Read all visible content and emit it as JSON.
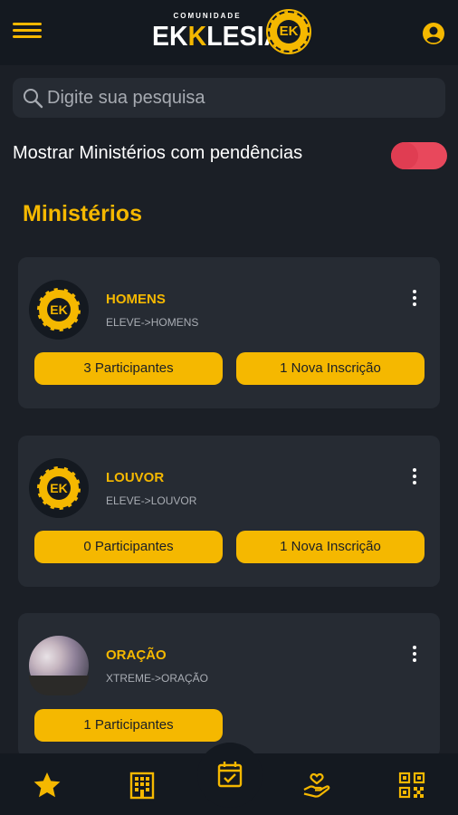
{
  "header": {
    "logo_small": "COMUNIDADE",
    "logo_pre": "EK",
    "logo_k": "K",
    "logo_post": "LESIA",
    "logo_badge": "EK",
    "menu_icon": "hamburger-icon",
    "user_icon": "account-circle-icon"
  },
  "search": {
    "placeholder": "Digite sua pesquisa",
    "value": ""
  },
  "filter": {
    "label": "Mostrar Ministérios com pendências",
    "toggle_on": true
  },
  "section_title": "Ministérios",
  "ministries": [
    {
      "name": "HOMENS",
      "path": "ELEVE->HOMENS",
      "avatar": "EK",
      "participants": "3 Participantes",
      "registrations": "1 Nova Inscrição"
    },
    {
      "name": "LOUVOR",
      "path": "ELEVE->LOUVOR",
      "avatar": "EK",
      "participants": "0 Participantes",
      "registrations": "1 Nova Inscrição"
    },
    {
      "name": "ORAÇÃO",
      "path": "XTREME->ORAÇÃO",
      "participants": "1 Participantes"
    }
  ],
  "bottom_nav": {
    "items": [
      "star-icon",
      "building-icon",
      "calendar-check-icon",
      "helping-hand-icon",
      "qr-code-icon"
    ],
    "active": "calendar-check-icon"
  },
  "colors": {
    "accent": "#f5b800",
    "background": "#1b1f26",
    "card": "#262b33",
    "toggle": "#e8485c"
  }
}
